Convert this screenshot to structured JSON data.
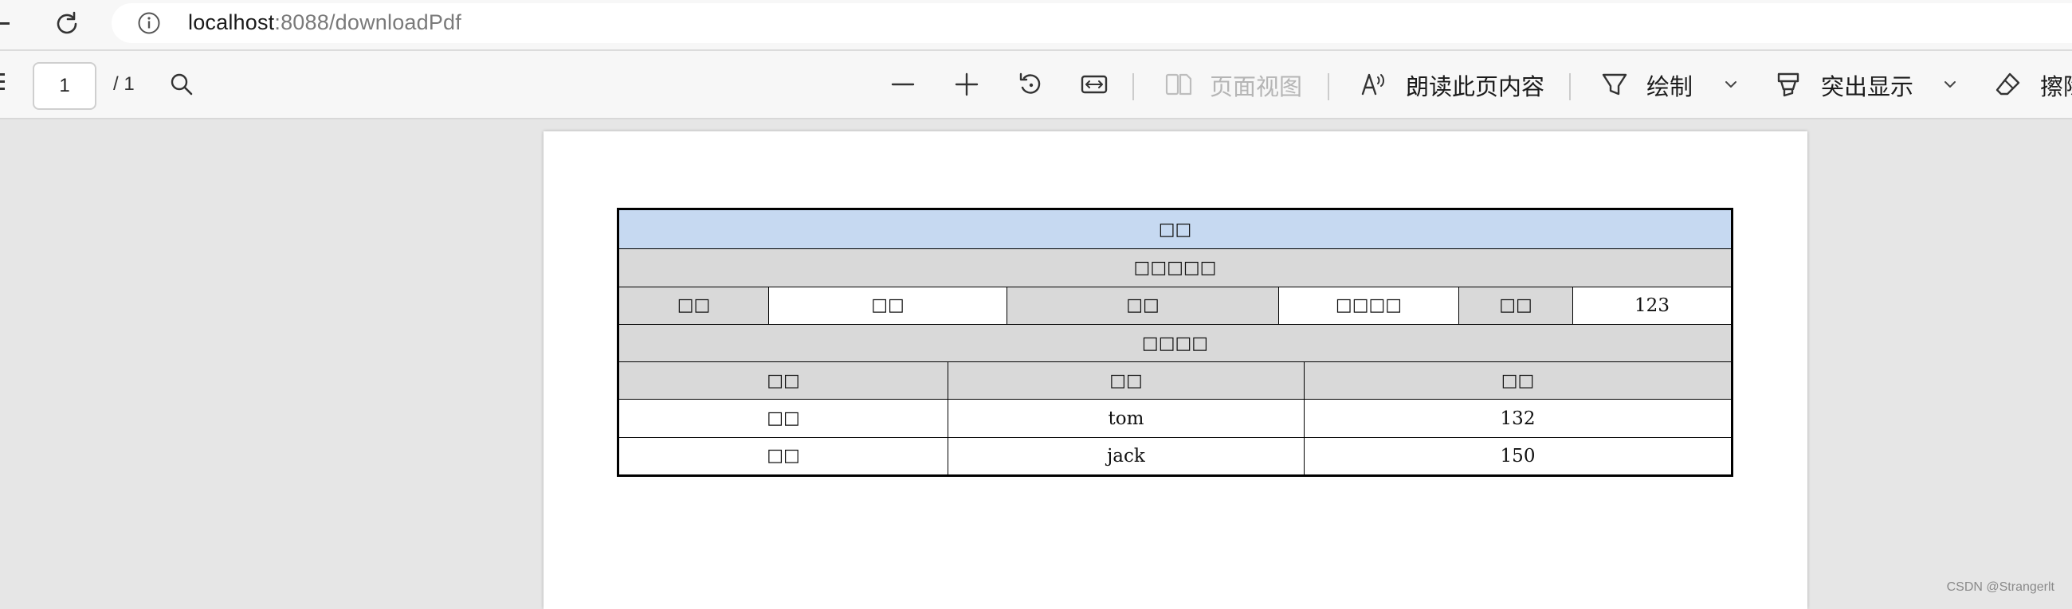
{
  "address_bar": {
    "url_host": "localhost",
    "url_rest": ":8088/downloadPdf"
  },
  "pdf_toolbar": {
    "page_current": "1",
    "page_total": "/ 1",
    "page_view_label": "页面视图",
    "read_aloud_label": "朗读此页内容",
    "draw_label": "绘制",
    "highlight_label": "突出显示",
    "erase_label": "擦除"
  },
  "document": {
    "title": "□□",
    "section1_header": "□□□□□",
    "info_row": [
      "□□",
      "□□",
      "□□",
      "□□□□",
      "□□",
      "123"
    ],
    "section2_header": "□□□□",
    "columns": [
      "□□",
      "□□",
      "□□"
    ],
    "rows": [
      [
        "□□",
        "tom",
        "132"
      ],
      [
        "□□",
        "jack",
        "150"
      ]
    ]
  },
  "watermark": "CSDN @Strangerlt"
}
